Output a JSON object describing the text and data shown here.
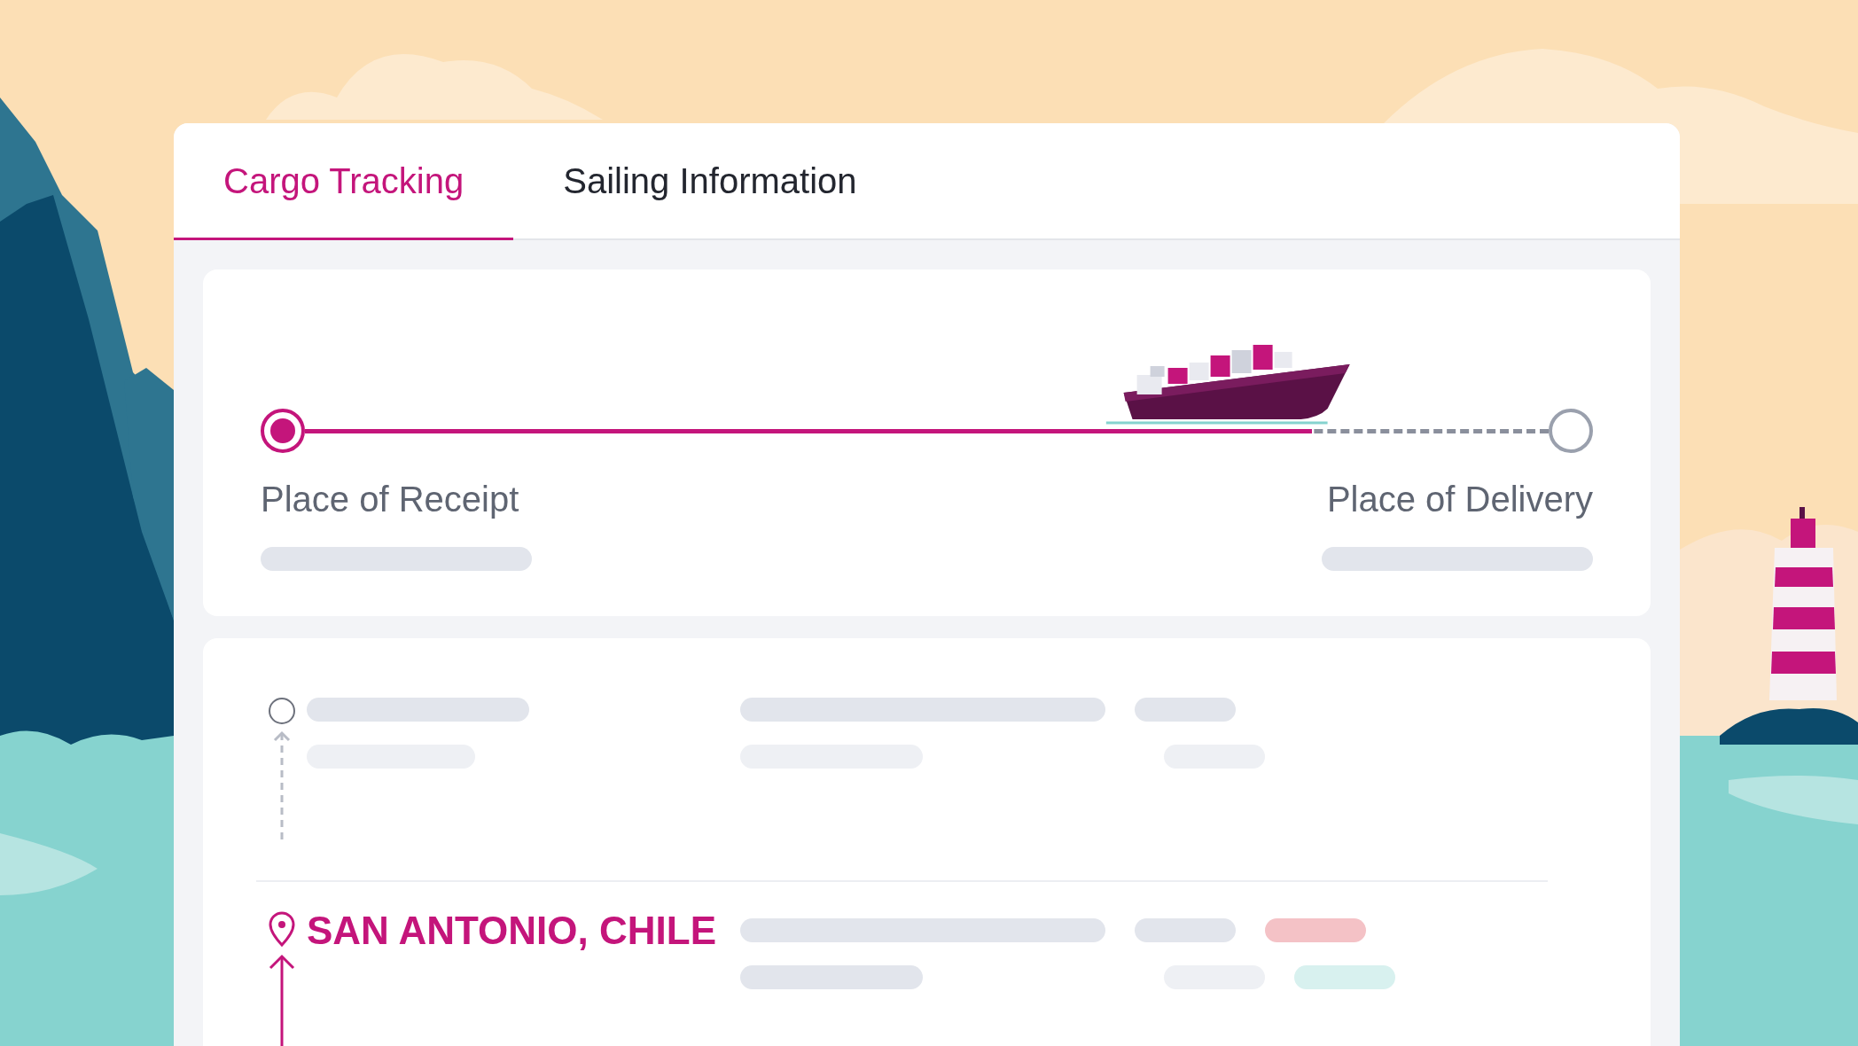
{
  "tabs": [
    {
      "label": "Cargo Tracking",
      "selected": true
    },
    {
      "label": "Sailing Information",
      "selected": false
    }
  ],
  "route": {
    "origin": "Place of Receipt",
    "destination": "Place of Delivery",
    "level": 0.81
  },
  "events": [
    {
      "kind": "pending"
    },
    {
      "kind": "current",
      "location": "SAN ANTONIO, CHILE"
    }
  ]
}
